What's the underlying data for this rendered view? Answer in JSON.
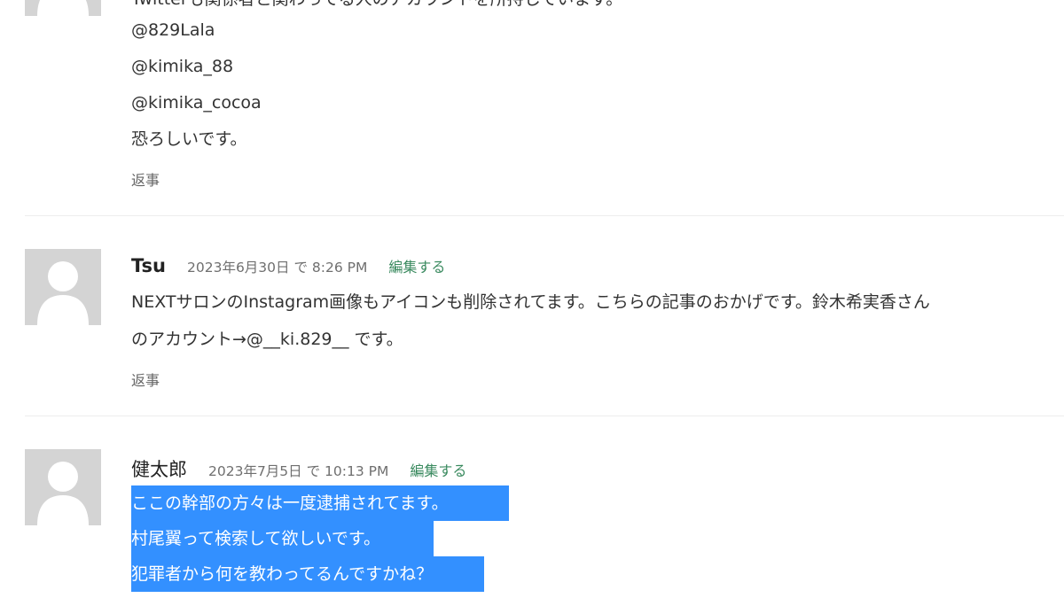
{
  "comments": [
    {
      "lines": [
        "Twitterも関係者と関わってる人のアカウントを所持しています。",
        "@829Lala",
        "@kimika_88",
        "@kimika_cocoa",
        "恐ろしいです。"
      ],
      "reply_label": "返事"
    },
    {
      "author": "Tsu",
      "date": "2023年6月30日 で 8:26 PM",
      "edit_label": "編集する",
      "lines": [
        "NEXTサロンのInstagram画像もアイコンも削除されてます。こちらの記事のおかげです。鈴木希実香さん",
        "のアカウント→@__ki.829__ です。"
      ],
      "reply_label": "返事"
    },
    {
      "author": "健太郎",
      "date": "2023年7月5日 で 10:13 PM",
      "edit_label": "編集する",
      "lines": [
        "ここの幹部の方々は一度逮捕されてます。",
        "村尾翼って検索して欲しいです。",
        "犯罪者から何を教わってるんですかね？"
      ]
    }
  ],
  "icons": {
    "avatar": "default-user-avatar-icon"
  },
  "colors": {
    "selection": "#3390ff",
    "edit_link": "#3a8a5f",
    "avatar_bg": "#d4d4d4"
  }
}
